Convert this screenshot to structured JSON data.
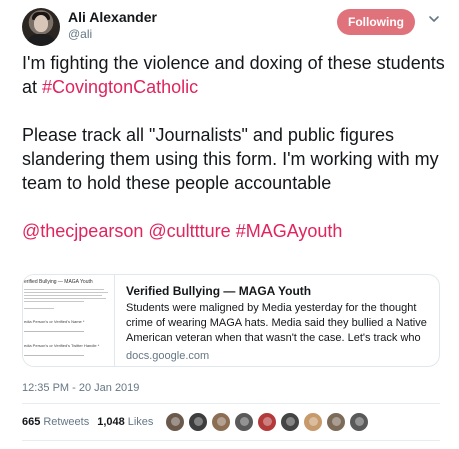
{
  "user": {
    "display_name": "Ali Alexander",
    "handle": "@ali",
    "follow_label": "Following"
  },
  "tweet": {
    "para1_text": "I'm fighting the violence and doxing of these students at ",
    "para1_tag": "#CovingtonCatholic",
    "para2_text": "Please track all \"Journalists\" and public figures slandering them using this form. I'm working with my team to hold these people accountable",
    "mention1": "@thecjpearson",
    "mention2": "@culttture",
    "hashtag": "#MAGAyouth"
  },
  "card": {
    "title": "Verified Bullying — MAGA Youth",
    "description": "Students were maligned by Media yesterday for the thought crime of wearing MAGA hats. Media said they bullied a Native American veteran when that wasn't the case. Let's track who said and did",
    "domain": "docs.google.com",
    "thumb_title": "erified Bullying — MAGA Youth",
    "thumb_label1": "edia Person's or Verified's Name *",
    "thumb_label2": "edia Person's or Verified's Twitter Handle *"
  },
  "timestamp": "12:35 PM - 20 Jan 2019",
  "stats": {
    "retweets_count": "665",
    "retweets_label": "Retweets",
    "likes_count": "1,048",
    "likes_label": "Likes"
  },
  "icons": {
    "caret": "chevron-down-icon"
  },
  "colors": {
    "follow_button": "#e0727c",
    "hashtag": "#e0245e",
    "meta_text": "#657786"
  },
  "likers": [
    {
      "color": "#6b5a4c"
    },
    {
      "color": "#3d3d3d"
    },
    {
      "color": "#8c6e55"
    },
    {
      "color": "#5a5a5a"
    },
    {
      "color": "#b23a3a"
    },
    {
      "color": "#444444"
    },
    {
      "color": "#c79a6b"
    },
    {
      "color": "#7d6b5a"
    },
    {
      "color": "#595959"
    }
  ]
}
